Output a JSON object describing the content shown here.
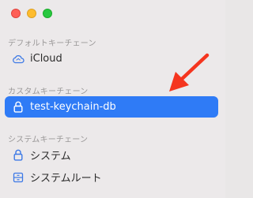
{
  "window": {
    "controls": [
      "close",
      "minimize",
      "zoom"
    ]
  },
  "sidebar": {
    "sections": [
      {
        "header": "デフォルトキーチェーン",
        "items": [
          {
            "label": "iCloud",
            "icon": "cloud-icon",
            "selected": false
          }
        ]
      },
      {
        "header": "カスタムキーチェーン",
        "items": [
          {
            "label": "test-keychain-db",
            "icon": "lock-icon",
            "selected": true
          }
        ]
      },
      {
        "header": "システムキーチェーン",
        "items": [
          {
            "label": "システム",
            "icon": "lock-icon",
            "selected": false
          },
          {
            "label": "システムルート",
            "icon": "cabinet-icon",
            "selected": false
          }
        ]
      }
    ]
  },
  "colors": {
    "selection": "#2f7bf6",
    "annotation_arrow": "#f5351f",
    "icon_blue": "#3c79e6"
  }
}
